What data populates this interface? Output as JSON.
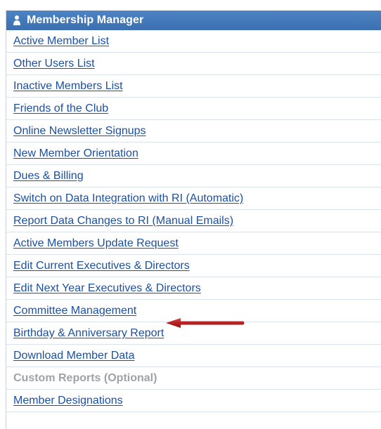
{
  "panel": {
    "title": "Membership Manager",
    "header_icon": "person-icon",
    "accent_color": "#3b6fb0"
  },
  "menu": {
    "items": [
      {
        "label": "Active Member List",
        "enabled": true
      },
      {
        "label": "Other Users List",
        "enabled": true
      },
      {
        "label": "Inactive Members List",
        "enabled": true
      },
      {
        "label": "Friends of the Club",
        "enabled": true
      },
      {
        "label": "Online Newsletter Signups",
        "enabled": true
      },
      {
        "label": "New Member Orientation",
        "enabled": true
      },
      {
        "label": "Dues & Billing",
        "enabled": true
      },
      {
        "label": "Switch on Data Integration with RI (Automatic)",
        "enabled": true
      },
      {
        "label": "Report Data Changes to RI (Manual Emails)",
        "enabled": true
      },
      {
        "label": "Active Members Update Request",
        "enabled": true
      },
      {
        "label": "Edit Current Executives & Directors",
        "enabled": true
      },
      {
        "label": "Edit Next Year Executives & Directors",
        "enabled": true
      },
      {
        "label": "Committee Management",
        "enabled": true,
        "highlighted": true
      },
      {
        "label": "Birthday & Anniversary Report",
        "enabled": true
      },
      {
        "label": "Download Member Data",
        "enabled": true
      },
      {
        "label": "Custom Reports (Optional)",
        "enabled": false
      },
      {
        "label": "Member Designations",
        "enabled": true
      }
    ]
  },
  "annotation": {
    "icon": "red-arrow-icon",
    "color": "#b31d1d"
  }
}
